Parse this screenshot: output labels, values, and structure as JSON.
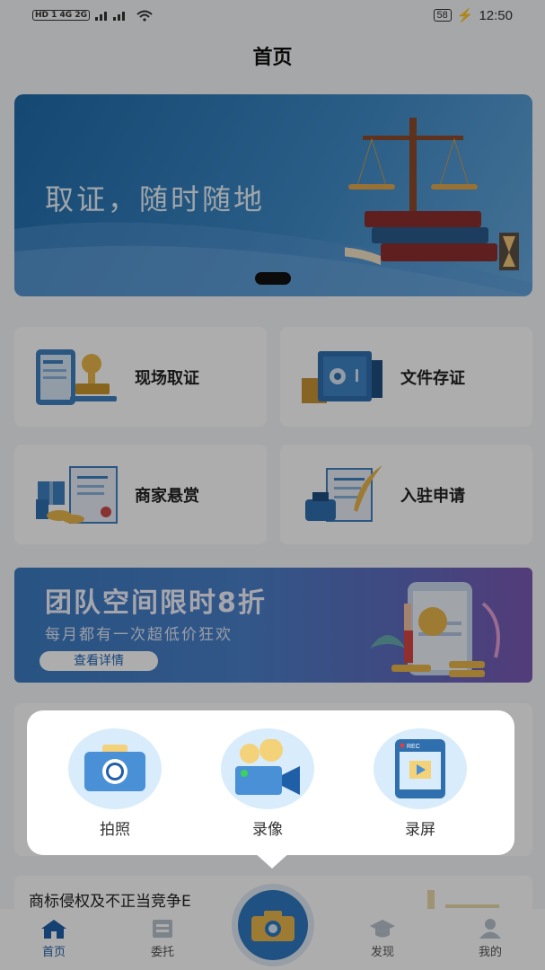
{
  "status_bar": {
    "left": "HD 1 4G 2G",
    "battery": "58",
    "time": "12:50"
  },
  "header": {
    "title": "首页"
  },
  "banner": {
    "text": "取证，随时随地"
  },
  "features": [
    {
      "label": "现场取证",
      "icon": "phone-stamp-icon"
    },
    {
      "label": "文件存证",
      "icon": "safe-icon"
    },
    {
      "label": "商家悬赏",
      "icon": "gift-certificate-icon"
    },
    {
      "label": "入驻申请",
      "icon": "ink-quill-icon"
    }
  ],
  "promo": {
    "title": "团队空间限时8折",
    "subtitle": "每月都有一次超低价狂欢",
    "button": "查看详情"
  },
  "article": {
    "title": "商标侵权及不正当竞争E"
  },
  "popup": {
    "items": [
      {
        "label": "拍照",
        "icon": "camera-icon"
      },
      {
        "label": "录像",
        "icon": "video-camera-icon"
      },
      {
        "label": "录屏",
        "icon": "screen-record-icon"
      }
    ],
    "rec_text": "REC"
  },
  "tabbar": {
    "items": [
      {
        "label": "首页",
        "icon": "home-icon",
        "active": true
      },
      {
        "label": "委托",
        "icon": "delegate-icon",
        "active": false
      },
      {
        "label": "发现",
        "icon": "graduation-cap-icon",
        "active": false
      },
      {
        "label": "我的",
        "icon": "user-icon",
        "active": false
      }
    ]
  },
  "colors": {
    "accent": "#1f5fa8",
    "popup_circle": "#d8ecfb",
    "overlay": "rgba(0,0,0,0.32)"
  }
}
